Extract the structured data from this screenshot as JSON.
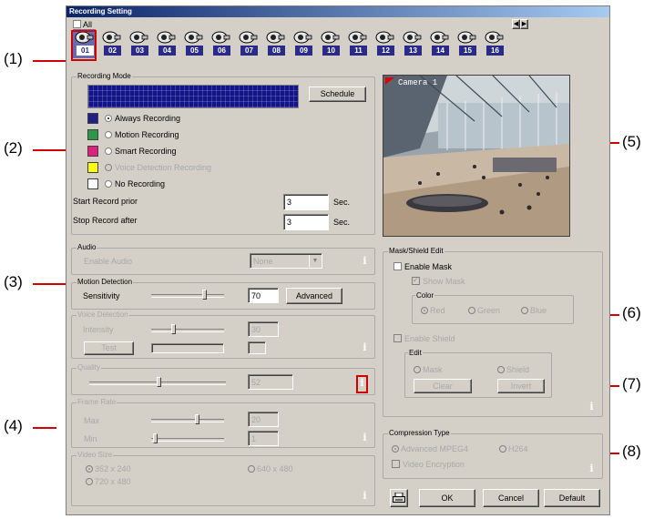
{
  "callouts": {
    "c1": "(1)",
    "c2": "(2)",
    "c3": "(3)",
    "c4": "(4)",
    "c5": "(5)",
    "c6": "(6)",
    "c7": "(7)",
    "c8": "(8)"
  },
  "window": {
    "title": "Recording Setting"
  },
  "camera_bar": {
    "all_label": "All",
    "cameras": [
      "01",
      "02",
      "03",
      "04",
      "05",
      "06",
      "07",
      "08",
      "09",
      "10",
      "11",
      "12",
      "13",
      "14",
      "15",
      "16"
    ],
    "selected": "01"
  },
  "recording_mode": {
    "title": "Recording Mode",
    "schedule_label": "Schedule",
    "modes": [
      {
        "label": "Always Recording",
        "color": "#202088",
        "selected": true,
        "disabled": false
      },
      {
        "label": "Motion Recording",
        "color": "#2a9a4a",
        "selected": false,
        "disabled": false
      },
      {
        "label": "Smart Recording",
        "color": "#e0207a",
        "selected": false,
        "disabled": false
      },
      {
        "label": "Voice Detection Recording",
        "color": "#ffff00",
        "selected": false,
        "disabled": true
      },
      {
        "label": "No Recording",
        "color": "#ffffff",
        "selected": false,
        "disabled": false
      }
    ],
    "start_prior_label": "Start Record prior",
    "start_prior_value": "3",
    "start_unit": "Sec.",
    "stop_after_label": "Stop Record after",
    "stop_after_value": "3",
    "stop_unit": "Sec."
  },
  "audio": {
    "title": "Audio",
    "enable_label": "Enable Audio",
    "value": "None"
  },
  "motion_detection": {
    "title": "Motion Detection",
    "sensitivity_label": "Sensitivity",
    "value": "70",
    "advanced_label": "Advanced"
  },
  "voice_detection": {
    "title": "Voice Detection",
    "intensity_label": "Intensity",
    "value": "30",
    "test_label": "Test"
  },
  "quality": {
    "title": "Quality",
    "value": "52"
  },
  "frame_rate": {
    "title": "Frame Rate",
    "max_label": "Max",
    "max_value": "20",
    "min_label": "Min",
    "min_value": "1"
  },
  "video_size": {
    "title": "Video Size",
    "opt1": "352 x 240",
    "opt2": "640 x 480",
    "opt3": "720 x 480"
  },
  "camera_preview": {
    "label": "Camera 1"
  },
  "mask": {
    "title": "Mask/Shield Edit",
    "enable_mask": "Enable Mask",
    "show_mask": "Show Mask",
    "color_title": "Color",
    "red": "Red",
    "green": "Green",
    "blue": "Blue",
    "enable_shield": "Enable Shield",
    "edit_title": "Edit",
    "mask_opt": "Mask",
    "shield_opt": "Shield",
    "clear_label": "Clear",
    "invert_label": "Invert"
  },
  "compression": {
    "title": "Compression Type",
    "mpeg4": "Advanced MPEG4",
    "h264": "H264",
    "encryption": "Video Encryption"
  },
  "footer": {
    "ok": "OK",
    "cancel": "Cancel",
    "default": "Default"
  }
}
